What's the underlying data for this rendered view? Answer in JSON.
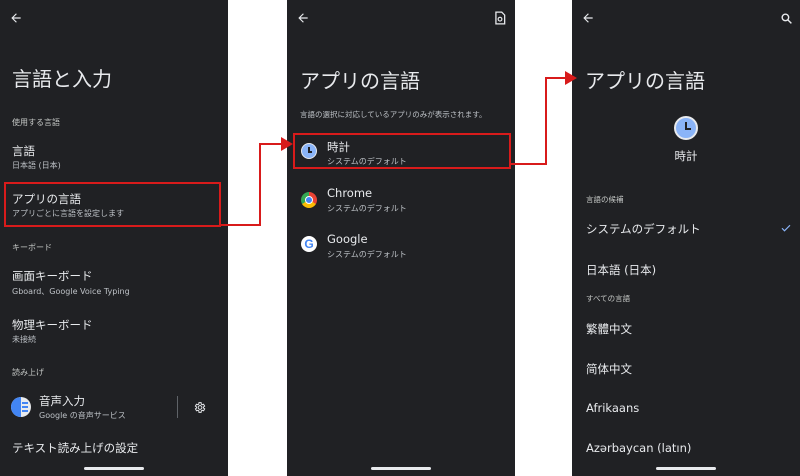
{
  "screen1": {
    "title": "言語と入力",
    "section_used_languages": "使用する言語",
    "languages": {
      "title": "言語",
      "subtitle": "日本語 (日本)"
    },
    "app_languages": {
      "title": "アプリの言語",
      "subtitle": "アプリごとに言語を設定します"
    },
    "section_keyboard": "キーボード",
    "onscreen_keyboard": {
      "title": "画面キーボード",
      "subtitle": "Gboard、Google Voice Typing"
    },
    "physical_keyboard": {
      "title": "物理キーボード",
      "subtitle": "未接続"
    },
    "section_read_aloud": "読み上げ",
    "voice_input": {
      "title": "音声入力",
      "subtitle": "Google の音声サービス"
    },
    "tts": {
      "title": "テキスト読み上げの設定"
    }
  },
  "screen2": {
    "title": "アプリの言語",
    "description": "言語の選択に対応しているアプリのみが表示されます。",
    "apps": [
      {
        "name": "時計",
        "subtitle": "システムのデフォルト",
        "icon": "clock-icon"
      },
      {
        "name": "Chrome",
        "subtitle": "システムのデフォルト",
        "icon": "chrome-icon"
      },
      {
        "name": "Google",
        "subtitle": "システムのデフォルト",
        "icon": "google-icon"
      }
    ]
  },
  "screen3": {
    "title": "アプリの言語",
    "app_name": "時計",
    "section_suggested": "言語の候補",
    "suggested": [
      "システムのデフォルト",
      "日本語 (日本)"
    ],
    "section_all": "すべての言語",
    "all_languages": [
      "繁體中文",
      "简体中文",
      "Afrikaans",
      "Azərbaycan (latın)"
    ]
  },
  "colors": {
    "background": "#202124",
    "highlight": "#d81b1b",
    "accent_blue": "#8ab4f8",
    "text": "#e8eaed"
  }
}
